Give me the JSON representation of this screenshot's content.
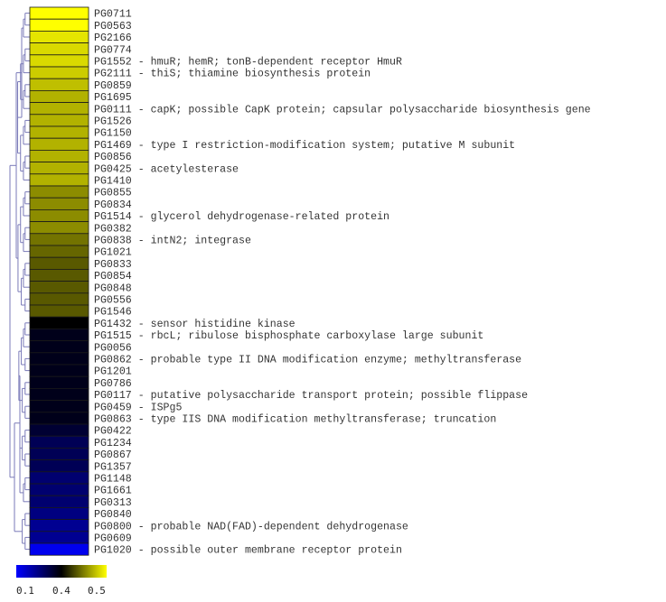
{
  "chart_data": {
    "type": "heatmap",
    "title": "",
    "xlabel": "",
    "ylabel": "",
    "color_scale": {
      "stops": [
        {
          "value": 0.1,
          "color": "#0000ff"
        },
        {
          "value": 0.4,
          "color": "#000000"
        },
        {
          "value": 0.5,
          "color": "#ffff00"
        }
      ],
      "tick_labels": [
        "0.1",
        "0.4",
        "0.5"
      ],
      "legend_position": "bottom-left"
    },
    "dendrogram": {
      "side": "left",
      "color": "#7a7ab8"
    },
    "rows": [
      {
        "id": "PG0711",
        "annotation": "",
        "value": 0.5
      },
      {
        "id": "PG0563",
        "annotation": "",
        "value": 0.5
      },
      {
        "id": "PG2166",
        "annotation": "",
        "value": 0.49
      },
      {
        "id": "PG0774",
        "annotation": "",
        "value": 0.485
      },
      {
        "id": "PG1552",
        "annotation": "hmuR; hemR; tonB-dependent receptor HmuR",
        "value": 0.485
      },
      {
        "id": "PG2111",
        "annotation": "thiS; thiamine biosynthesis protein",
        "value": 0.48
      },
      {
        "id": "PG0859",
        "annotation": "",
        "value": 0.475
      },
      {
        "id": "PG1695",
        "annotation": "",
        "value": 0.47
      },
      {
        "id": "PG0111",
        "annotation": "capK; possible CapK protein; capsular polysaccharide biosynthesis gene",
        "value": 0.47
      },
      {
        "id": "PG1526",
        "annotation": "",
        "value": 0.47
      },
      {
        "id": "PG1150",
        "annotation": "",
        "value": 0.47
      },
      {
        "id": "PG1469",
        "annotation": "type I restriction-modification system; putative M subunit",
        "value": 0.47
      },
      {
        "id": "PG0856",
        "annotation": "",
        "value": 0.47
      },
      {
        "id": "PG0425",
        "annotation": "acetylesterase",
        "value": 0.47
      },
      {
        "id": "PG1410",
        "annotation": "",
        "value": 0.47
      },
      {
        "id": "PG0855",
        "annotation": "",
        "value": 0.455
      },
      {
        "id": "PG0834",
        "annotation": "",
        "value": 0.455
      },
      {
        "id": "PG1514",
        "annotation": "glycerol dehydrogenase-related protein",
        "value": 0.455
      },
      {
        "id": "PG0382",
        "annotation": "",
        "value": 0.455
      },
      {
        "id": "PG0838",
        "annotation": "intN2; integrase",
        "value": 0.445
      },
      {
        "id": "PG1021",
        "annotation": "",
        "value": 0.44
      },
      {
        "id": "PG0833",
        "annotation": "",
        "value": 0.435
      },
      {
        "id": "PG0854",
        "annotation": "",
        "value": 0.435
      },
      {
        "id": "PG0848",
        "annotation": "",
        "value": 0.435
      },
      {
        "id": "PG0556",
        "annotation": "",
        "value": 0.435
      },
      {
        "id": "PG1546",
        "annotation": "",
        "value": 0.435
      },
      {
        "id": "PG1432",
        "annotation": "sensor histidine kinase",
        "value": 0.4
      },
      {
        "id": "PG1515",
        "annotation": "rbcL; ribulose bisphosphate carboxylase large subunit",
        "value": 0.37
      },
      {
        "id": "PG0056",
        "annotation": "",
        "value": 0.37
      },
      {
        "id": "PG0862",
        "annotation": "probable type II DNA modification enzyme; methyltransferase",
        "value": 0.37
      },
      {
        "id": "PG1201",
        "annotation": "",
        "value": 0.37
      },
      {
        "id": "PG0786",
        "annotation": "",
        "value": 0.37
      },
      {
        "id": "PG0117",
        "annotation": "putative polysaccharide transport protein; possible flippase",
        "value": 0.37
      },
      {
        "id": "PG0459",
        "annotation": "ISPg5",
        "value": 0.37
      },
      {
        "id": "PG0863",
        "annotation": "type IIS DNA modification methyltransferase; truncation",
        "value": 0.37
      },
      {
        "id": "PG0422",
        "annotation": "",
        "value": 0.34
      },
      {
        "id": "PG1234",
        "annotation": "",
        "value": 0.3
      },
      {
        "id": "PG0867",
        "annotation": "",
        "value": 0.3
      },
      {
        "id": "PG1357",
        "annotation": "",
        "value": 0.3
      },
      {
        "id": "PG1148",
        "annotation": "",
        "value": 0.27
      },
      {
        "id": "PG1661",
        "annotation": "",
        "value": 0.27
      },
      {
        "id": "PG0313",
        "annotation": "",
        "value": 0.27
      },
      {
        "id": "PG0840",
        "annotation": "",
        "value": 0.25
      },
      {
        "id": "PG0800",
        "annotation": "probable NAD(FAD)-dependent dehydrogenase",
        "value": 0.23
      },
      {
        "id": "PG0609",
        "annotation": "",
        "value": 0.23
      },
      {
        "id": "PG1020",
        "annotation": "possible outer membrane receptor protein",
        "value": 0.12
      }
    ]
  }
}
